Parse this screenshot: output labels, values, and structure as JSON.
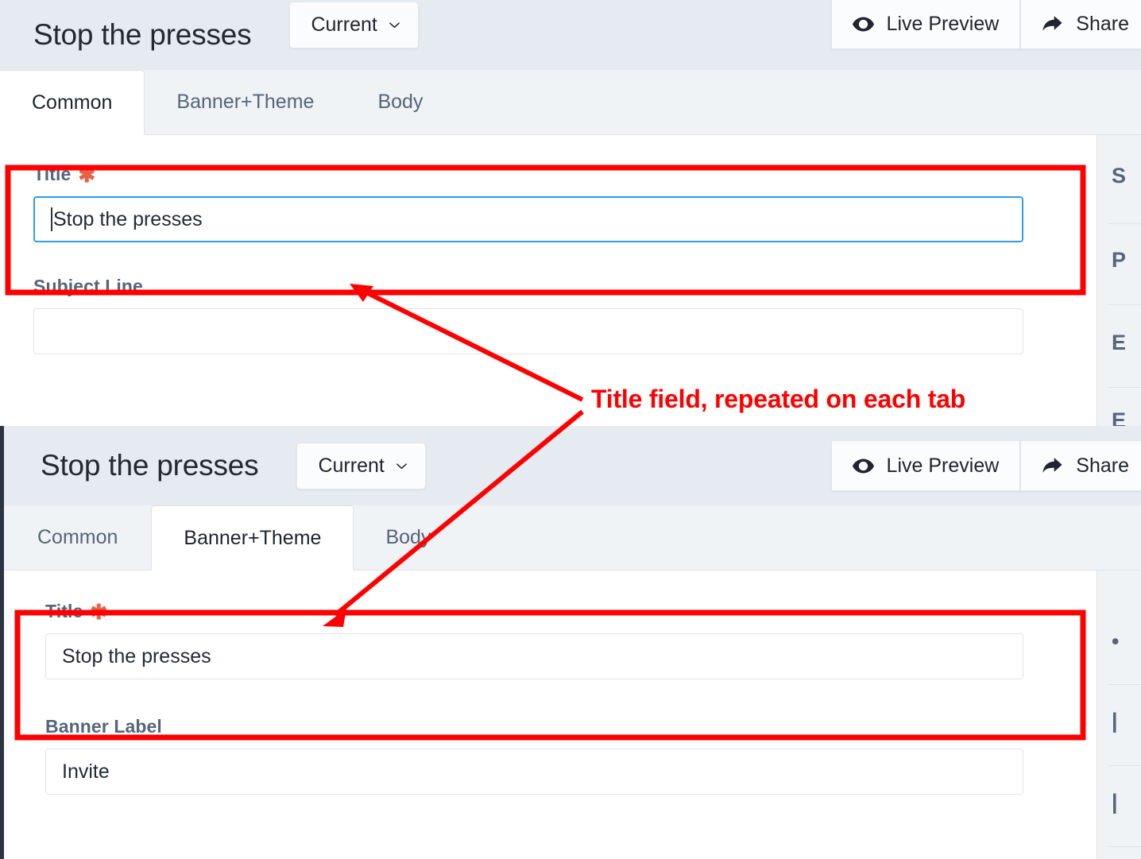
{
  "panels": [
    {
      "id": "panel-common",
      "header": {
        "title": "Stop the presses",
        "version_button": {
          "label": "Current",
          "icon": "chevron-down-icon"
        },
        "actions": [
          {
            "label": "Live Preview",
            "icon": "eye-icon"
          },
          {
            "label": "Share",
            "icon": "share-arrow-icon"
          }
        ]
      },
      "tabs": [
        {
          "label": "Common",
          "active": true
        },
        {
          "label": "Banner+Theme",
          "active": false
        },
        {
          "label": "Body",
          "active": false
        }
      ],
      "fields": [
        {
          "label": "Title",
          "required": true,
          "value": "Stop the presses",
          "placeholder": "",
          "focused": true,
          "highlighted": true
        },
        {
          "label": "Subject Line",
          "required": false,
          "value": "",
          "placeholder": "",
          "focused": false,
          "highlighted": false
        }
      ],
      "side_rail": [
        "S",
        "P",
        "E",
        "E"
      ]
    },
    {
      "id": "panel-banner-theme",
      "header": {
        "title": "Stop the presses",
        "version_button": {
          "label": "Current",
          "icon": "chevron-down-icon"
        },
        "actions": [
          {
            "label": "Live Preview",
            "icon": "eye-icon"
          },
          {
            "label": "Share",
            "icon": "share-arrow-icon"
          }
        ]
      },
      "tabs": [
        {
          "label": "Common",
          "active": false
        },
        {
          "label": "Banner+Theme",
          "active": true
        },
        {
          "label": "Body",
          "active": false
        }
      ],
      "fields": [
        {
          "label": "Title",
          "required": true,
          "value": "Stop the presses",
          "placeholder": "",
          "focused": false,
          "highlighted": true
        },
        {
          "label": "Banner Label",
          "required": false,
          "value": "Invite",
          "placeholder": "",
          "focused": false,
          "highlighted": false
        }
      ],
      "side_rail": [
        "",
        "",
        ""
      ]
    }
  ],
  "annotation": {
    "text": "Title field, repeated on each tab",
    "color": "#ff0000",
    "callout_boxes": 2,
    "arrows": 2
  },
  "colors": {
    "header_bg": "#e6ebf2",
    "tabbar_bg": "#f0f3f6",
    "panel_bg": "#ffffff",
    "label_text": "#54657c",
    "required_asterisk": "#e8614a",
    "input_focus_border": "#2f9cf0",
    "annotation_red": "#ff0000",
    "panel_left_edge": "#2b3440"
  }
}
